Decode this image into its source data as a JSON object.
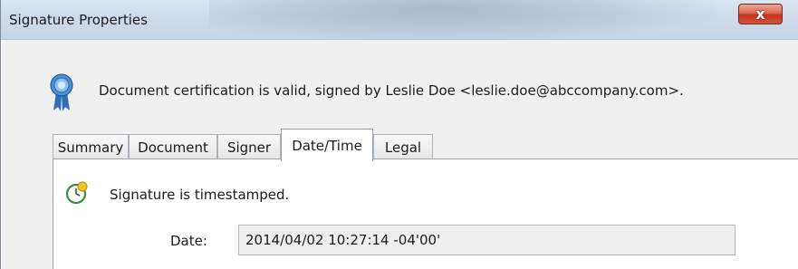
{
  "window": {
    "title": "Signature Properties",
    "close_symbol": "x"
  },
  "certification": {
    "icon": "ribbon-award-icon",
    "message": "Document certification is valid, signed by Leslie Doe <leslie.doe@abccompany.com>."
  },
  "tabs": [
    {
      "label": "Summary",
      "active": false
    },
    {
      "label": "Document",
      "active": false
    },
    {
      "label": "Signer",
      "active": false
    },
    {
      "label": "Date/Time",
      "active": true
    },
    {
      "label": "Legal",
      "active": false
    }
  ],
  "datetime": {
    "icon": "clock-icon",
    "message": "Signature is timestamped.",
    "date_label": "Date:",
    "date_value": "2014/04/02 10:27:14 -04'00'"
  },
  "colors": {
    "titlebar": "#cddbea",
    "close_button": "#c3361c",
    "ribbon_blue": "#4a90d9",
    "clock_yellow": "#f2c32e"
  }
}
